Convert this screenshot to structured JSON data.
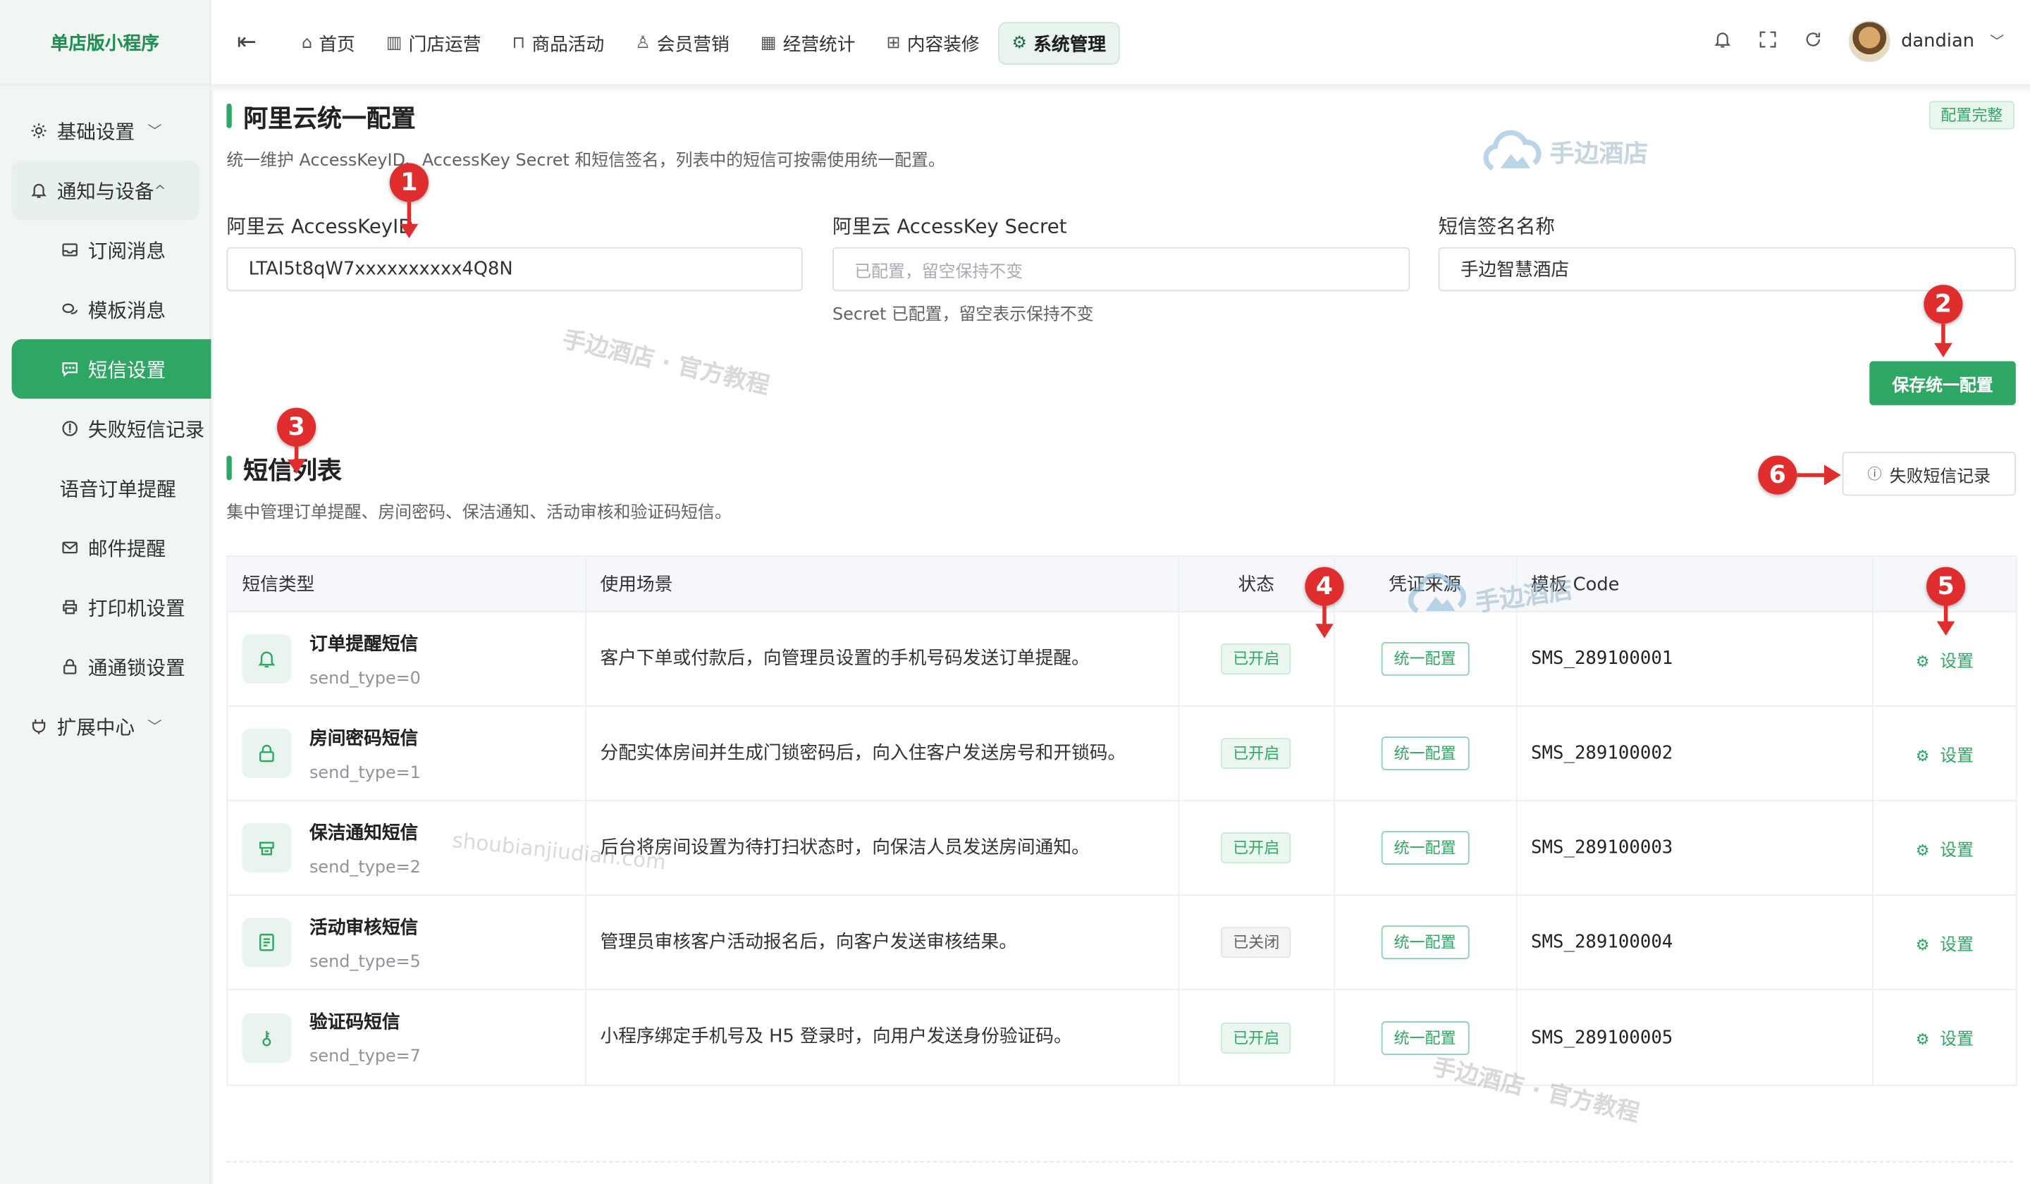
{
  "sidebar": {
    "brand": "单店版小程序",
    "items": [
      {
        "label": "基础设置",
        "icon": "gear-icon",
        "kind": "group"
      },
      {
        "label": "通知与设备",
        "icon": "bell-icon",
        "kind": "group-open"
      },
      {
        "label": "订阅消息",
        "icon": "inbox-icon",
        "kind": "sub"
      },
      {
        "label": "模板消息",
        "icon": "chat-icon",
        "kind": "sub"
      },
      {
        "label": "短信设置",
        "icon": "message-icon",
        "kind": "active"
      },
      {
        "label": "失败短信记录",
        "icon": "info-icon",
        "kind": "sub"
      },
      {
        "label": "语音订单提醒",
        "icon": "",
        "kind": "sub"
      },
      {
        "label": "邮件提醒",
        "icon": "mail-icon",
        "kind": "sub"
      },
      {
        "label": "打印机设置",
        "icon": "printer-icon",
        "kind": "sub"
      },
      {
        "label": "通通锁设置",
        "icon": "lock-icon",
        "kind": "sub"
      },
      {
        "label": "扩展中心",
        "icon": "plug-icon",
        "kind": "group"
      }
    ]
  },
  "topbar": {
    "nav": [
      {
        "label": "首页",
        "icon": "home-icon"
      },
      {
        "label": "门店运营",
        "icon": "store-icon"
      },
      {
        "label": "商品活动",
        "icon": "bag-icon"
      },
      {
        "label": "会员营销",
        "icon": "user-icon"
      },
      {
        "label": "经营统计",
        "icon": "chart-icon"
      },
      {
        "label": "内容装修",
        "icon": "layout-icon"
      },
      {
        "label": "系统管理",
        "icon": "gear-icon",
        "active": true
      }
    ],
    "username": "dandian"
  },
  "aliyun": {
    "title": "阿里云统一配置",
    "desc": "统一维护 AccessKeyID、AccessKey Secret 和短信签名，列表中的短信可按需使用统一配置。",
    "badge": "配置完整",
    "key_id_label": "阿里云 AccessKeyID",
    "key_id_value": "LTAI5t8qW7xxxxxxxxxx4Q8N",
    "secret_label": "阿里云 AccessKey Secret",
    "secret_placeholder": "已配置，留空保持不变",
    "secret_hint": "Secret 已配置，留空表示保持不变",
    "sign_label": "短信签名名称",
    "sign_value": "手边智慧酒店",
    "save_button": "保存统一配置"
  },
  "sms_list": {
    "title": "短信列表",
    "desc": "集中管理订单提醒、房间密码、保洁通知、活动审核和验证码短信。",
    "failed_button": "失败短信记录",
    "headers": [
      "短信类型",
      "使用场景",
      "状态",
      "凭证来源",
      "模板 Code",
      ""
    ],
    "rows": [
      {
        "icon": "bell-icon",
        "name": "订单提醒短信",
        "type": "send_type=0",
        "scene": "客户下单或付款后，向管理员设置的手机号码发送订单提醒。",
        "status": "已开启",
        "status_on": true,
        "source": "统一配置",
        "code": "SMS_289100001",
        "action": "设置"
      },
      {
        "icon": "lock-icon",
        "name": "房间密码短信",
        "type": "send_type=1",
        "scene": "分配实体房间并生成门锁密码后，向入住客户发送房号和开锁码。",
        "status": "已开启",
        "status_on": true,
        "source": "统一配置",
        "code": "SMS_289100002",
        "action": "设置"
      },
      {
        "icon": "broom-icon",
        "name": "保洁通知短信",
        "type": "send_type=2",
        "scene": "后台将房间设置为待打扫状态时，向保洁人员发送房间通知。",
        "status": "已开启",
        "status_on": true,
        "source": "统一配置",
        "code": "SMS_289100003",
        "action": "设置"
      },
      {
        "icon": "document-icon",
        "name": "活动审核短信",
        "type": "send_type=5",
        "scene": "管理员审核客户活动报名后，向客户发送审核结果。",
        "status": "已关闭",
        "status_on": false,
        "source": "统一配置",
        "code": "SMS_289100004",
        "action": "设置"
      },
      {
        "icon": "key-icon",
        "name": "验证码短信",
        "type": "send_type=7",
        "scene": "小程序绑定手机号及 H5 登录时，向用户发送身份验证码。",
        "status": "已开启",
        "status_on": true,
        "source": "统一配置",
        "code": "SMS_289100005",
        "action": "设置"
      }
    ]
  },
  "watermarks": {
    "logo_text": "手边酒店",
    "tutorial": "手边酒店 · 官方教程",
    "domain": "shoubianjiudian.com"
  },
  "annotations": [
    "1",
    "2",
    "3",
    "4",
    "5",
    "6"
  ],
  "colors": {
    "accent": "#2ea764",
    "annotation": "#e02d2d"
  }
}
